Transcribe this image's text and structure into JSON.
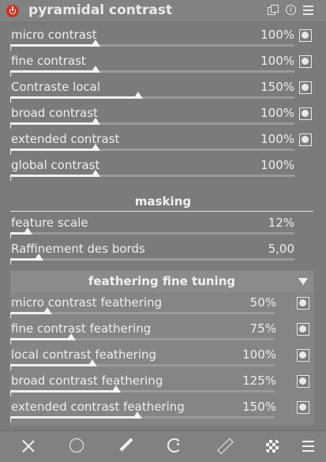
{
  "header": {
    "title": "pyramidal contrast",
    "power_icon": "power-icon",
    "copy_icon": "multi-instance-icon",
    "reset_icon": "reset-icon",
    "menu_icon": "presets-menu-icon"
  },
  "sliders": [
    {
      "label": "micro contrast",
      "value": "100%",
      "level": 0.3,
      "mask": true
    },
    {
      "label": "fine contrast",
      "value": "100%",
      "level": 0.3,
      "mask": true
    },
    {
      "label": "Contraste local",
      "value": "150%",
      "level": 0.45,
      "mask": true
    },
    {
      "label": "broad contrast",
      "value": "100%",
      "level": 0.3,
      "mask": true
    },
    {
      "label": "extended contrast",
      "value": "100%",
      "level": 0.3,
      "mask": true
    },
    {
      "label": "global contrast",
      "value": "100%",
      "level": 0.3,
      "mask": false
    }
  ],
  "masking": {
    "title": "masking",
    "sliders": [
      {
        "label": "feature scale",
        "value": "12%",
        "level": 0.06
      },
      {
        "label": "Raffinement des bords",
        "value": "5,00",
        "level": 0.1
      }
    ]
  },
  "feathering": {
    "title": "feathering fine tuning",
    "sliders": [
      {
        "label": "micro contrast feathering",
        "value": "50%",
        "level": 0.14
      },
      {
        "label": "fine contrast feathering",
        "value": "75%",
        "level": 0.23
      },
      {
        "label": "local contrast feathering",
        "value": "100%",
        "level": 0.31
      },
      {
        "label": "broad contrast feathering",
        "value": "125%",
        "level": 0.4
      },
      {
        "label": "extended contrast feathering",
        "value": "150%",
        "level": 0.48
      }
    ]
  },
  "bottom_toolbar": [
    "off-icon",
    "uniform-icon",
    "drawn-mask-icon",
    "parametric-mask-icon",
    "drawn-parametric-icon",
    "raster-mask-icon",
    "blend-menu-icon"
  ]
}
